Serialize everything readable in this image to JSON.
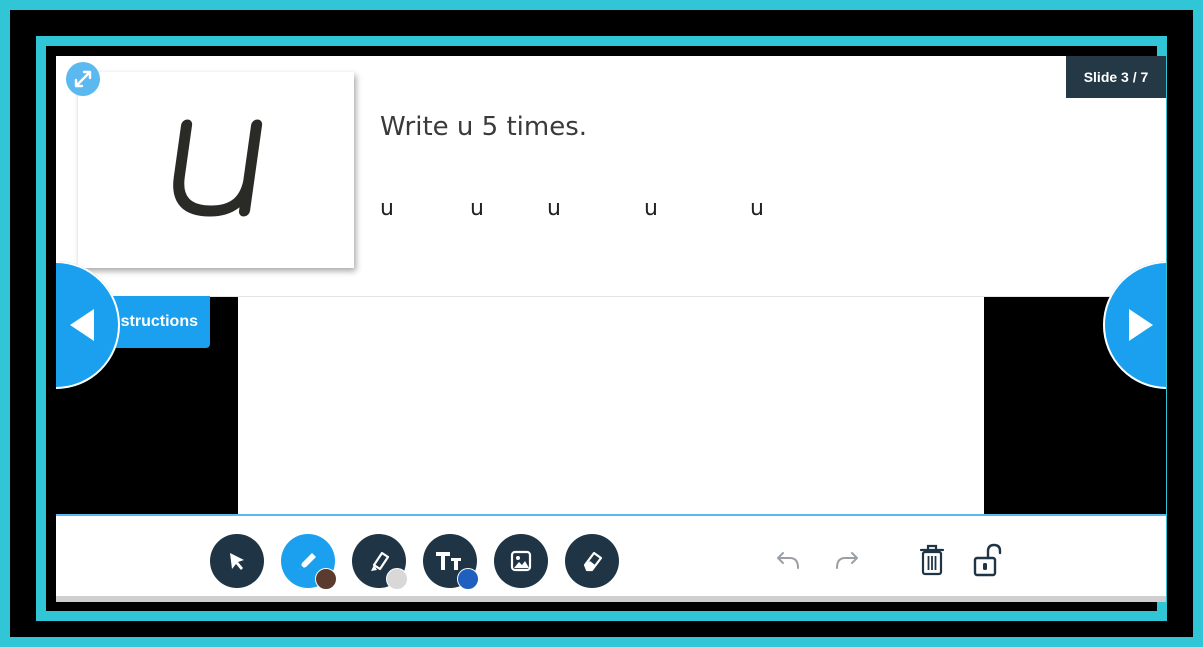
{
  "slide": {
    "counter": "Slide 3 / 7",
    "instructions_tab": "Instructions",
    "prompt": "Write u 5 times.",
    "letter_card_glyph": "u",
    "sample_letters": [
      "u",
      "u",
      "u",
      "u",
      "u"
    ]
  },
  "colors": {
    "frame": "#31c6d6",
    "accent": "#1aa0ef",
    "tool_dark": "#1f3444",
    "counter_bg": "#253846"
  },
  "toolbar": {
    "tools": [
      {
        "name": "select",
        "icon": "cursor-arrow-icon"
      },
      {
        "name": "pen",
        "icon": "pencil-icon",
        "active": true,
        "swatch": "#5a3b2e"
      },
      {
        "name": "highlighter",
        "icon": "highlighter-icon",
        "swatch": "#d8d8d8"
      },
      {
        "name": "text",
        "icon": "text-tt-icon",
        "label": "Tt",
        "swatch": "#1f5fbf"
      },
      {
        "name": "image",
        "icon": "image-icon"
      },
      {
        "name": "eraser",
        "icon": "eraser-icon"
      }
    ],
    "actions": [
      {
        "name": "undo",
        "icon": "undo-icon"
      },
      {
        "name": "redo",
        "icon": "redo-icon"
      },
      {
        "name": "delete",
        "icon": "trash-icon"
      },
      {
        "name": "lock",
        "icon": "unlock-icon"
      }
    ]
  }
}
